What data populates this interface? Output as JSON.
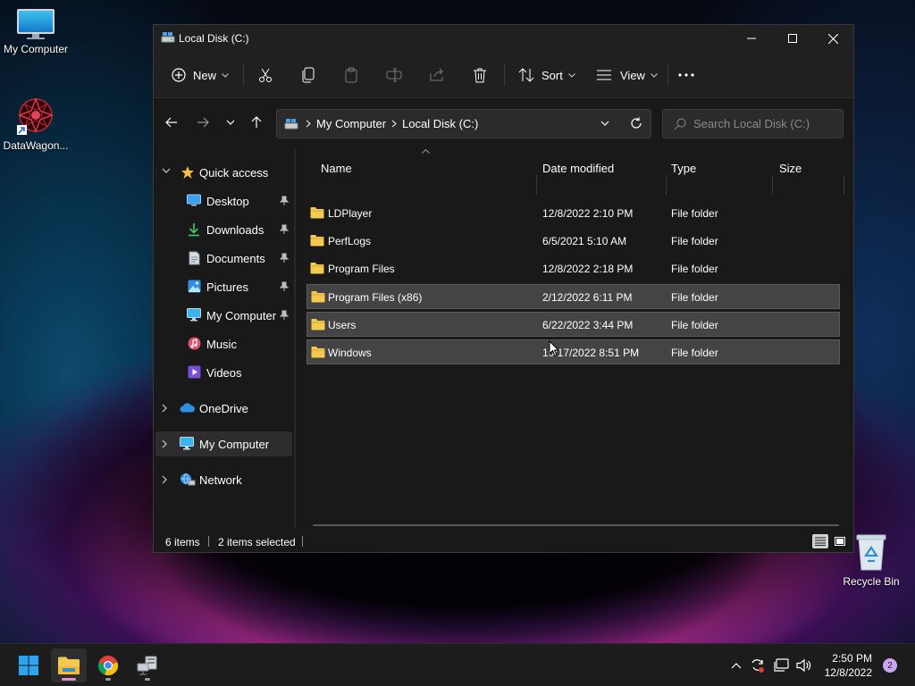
{
  "desktop": {
    "icons": [
      {
        "label": "My Computer",
        "icon": "monitor-icon"
      },
      {
        "label": "DataWagon...",
        "icon": "datawagon-shortcut-icon"
      },
      {
        "label": "Recycle Bin",
        "icon": "recycle-bin-icon"
      }
    ]
  },
  "window": {
    "title": "Local Disk (C:)",
    "controls": {
      "minimize": "minimize-icon",
      "maximize": "maximize-icon",
      "close": "close-icon"
    }
  },
  "toolbar": {
    "new_label": "New",
    "sort_label": "Sort",
    "view_label": "View",
    "icons": [
      "plus-icon",
      "cut-icon",
      "copy-icon",
      "paste-icon",
      "rename-icon",
      "share-icon",
      "delete-icon",
      "sort-icon",
      "view-icon",
      "more-icon"
    ]
  },
  "address": {
    "crumbs": [
      "My Computer",
      "Local Disk (C:)"
    ],
    "search_placeholder": "Search Local Disk (C:)"
  },
  "sidebar": {
    "quick_access": "Quick access",
    "items": [
      {
        "label": "Desktop",
        "pinned": true,
        "icon": "desktop-icon"
      },
      {
        "label": "Downloads",
        "pinned": true,
        "icon": "download-icon"
      },
      {
        "label": "Documents",
        "pinned": true,
        "icon": "document-icon"
      },
      {
        "label": "Pictures",
        "pinned": true,
        "icon": "picture-icon"
      },
      {
        "label": "My Computer",
        "pinned": true,
        "icon": "monitor-icon"
      },
      {
        "label": "Music",
        "pinned": false,
        "icon": "music-icon"
      },
      {
        "label": "Videos",
        "pinned": false,
        "icon": "video-icon"
      }
    ],
    "onedrive": "OneDrive",
    "my_computer": "My Computer",
    "network": "Network"
  },
  "filelist": {
    "columns": {
      "name": "Name",
      "date": "Date modified",
      "type": "Type",
      "size": "Size"
    },
    "rows": [
      {
        "name": "LDPlayer",
        "date": "12/8/2022 2:10 PM",
        "type": "File folder",
        "size": "",
        "selected": false
      },
      {
        "name": "PerfLogs",
        "date": "6/5/2021 5:10 AM",
        "type": "File folder",
        "size": "",
        "selected": false
      },
      {
        "name": "Program Files",
        "date": "12/8/2022 2:18 PM",
        "type": "File folder",
        "size": "",
        "selected": false
      },
      {
        "name": "Program Files (x86)",
        "date": "2/12/2022 6:11 PM",
        "type": "File folder",
        "size": "",
        "selected": true
      },
      {
        "name": "Users",
        "date": "6/22/2022 3:44 PM",
        "type": "File folder",
        "size": "",
        "selected": true
      },
      {
        "name": "Windows",
        "date": "10/17/2022 8:51 PM",
        "type": "File folder",
        "size": "",
        "selected": true
      }
    ]
  },
  "status": {
    "items_count": "6 items",
    "selected_count": "2 items selected"
  },
  "taskbar": {
    "apps": [
      "start-icon",
      "file-explorer-icon",
      "chrome-icon",
      "network-drive-icon"
    ],
    "clock_time": "2:50 PM",
    "clock_date": "12/8/2022",
    "notification_count": "2"
  },
  "colors": {
    "window_bg": "#191919",
    "titlebar_bg": "#202020",
    "selection_bg": "#444444",
    "folder_yellow": "#f3c94f",
    "accent_blue": "#3aa0f0"
  }
}
